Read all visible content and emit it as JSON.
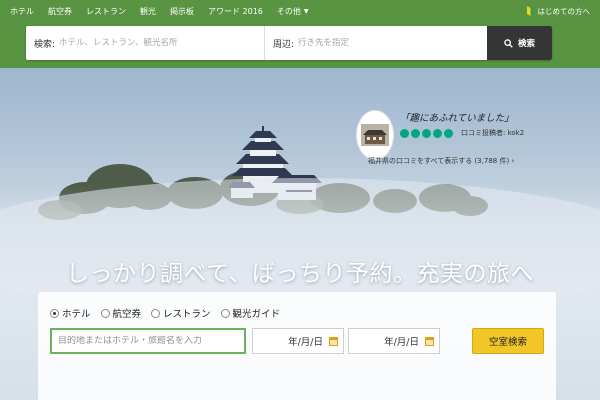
{
  "nav": {
    "items": [
      {
        "label": "ホテル"
      },
      {
        "label": "航空券"
      },
      {
        "label": "レストラン"
      },
      {
        "label": "観光"
      },
      {
        "label": "掲示板"
      },
      {
        "label": "アワード 2016"
      },
      {
        "label": "その他"
      }
    ],
    "beginner_link": "はじめての方へ"
  },
  "search": {
    "keyword_label": "検索:",
    "keyword_placeholder": "ホテル、レストラン、観光名所",
    "near_label": "周辺:",
    "near_placeholder": "行き先を指定",
    "button_label": "検索"
  },
  "hero": {
    "headline": "しっかり調べて、ばっちり予約。充実の旅へ",
    "review": {
      "quote": "「趣にあふれていました」",
      "rating": 5,
      "reviewer": "口コミ投稿者: kok2",
      "link": "福井県の口コミをすべて表示する (3,788 件) ›"
    }
  },
  "booking": {
    "tabs": [
      {
        "label": "ホテル",
        "checked": true
      },
      {
        "label": "航空券",
        "checked": false
      },
      {
        "label": "レストラン",
        "checked": false
      },
      {
        "label": "観光ガイド",
        "checked": false
      }
    ],
    "destination_placeholder": "目的地またはホテル・旅館名を入力",
    "checkin": "年/月/日",
    "checkout": "年/月/日",
    "submit_label": "空室検索"
  },
  "colors": {
    "brand_green": "#589442",
    "rating_green": "#00a680",
    "cta_yellow": "#f3c628",
    "search_button": "#353535"
  }
}
